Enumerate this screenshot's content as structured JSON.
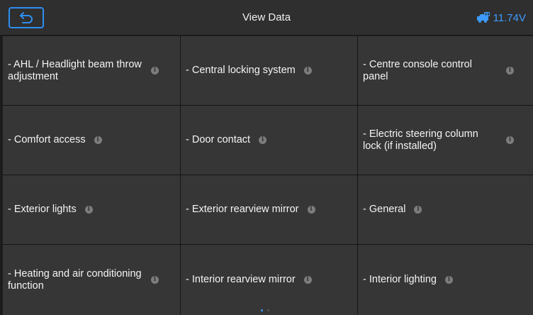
{
  "header": {
    "title": "View Data",
    "voltage": "11.74V"
  },
  "items": [
    {
      "label": "- AHL / Headlight beam throw adjustment"
    },
    {
      "label": "- Central locking system"
    },
    {
      "label": "- Centre console control panel"
    },
    {
      "label": "- Comfort access"
    },
    {
      "label": "- Door contact"
    },
    {
      "label": "- Electric steering column lock (if installed)"
    },
    {
      "label": "- Exterior lights"
    },
    {
      "label": "- Exterior rearview mirror"
    },
    {
      "label": "- General"
    },
    {
      "label": "- Heating and air conditioning function"
    },
    {
      "label": "- Interior rearview mirror"
    },
    {
      "label": "- Interior lighting"
    }
  ],
  "icons": {
    "back": "back-arrow-icon",
    "vehicle": "car-battery-icon",
    "info": "info-icon"
  },
  "colors": {
    "accent": "#2e8ef0",
    "header_bg": "#2f2f2f",
    "cell_bg": "#363636"
  },
  "pagination": {
    "pages": 2,
    "current": 1
  }
}
